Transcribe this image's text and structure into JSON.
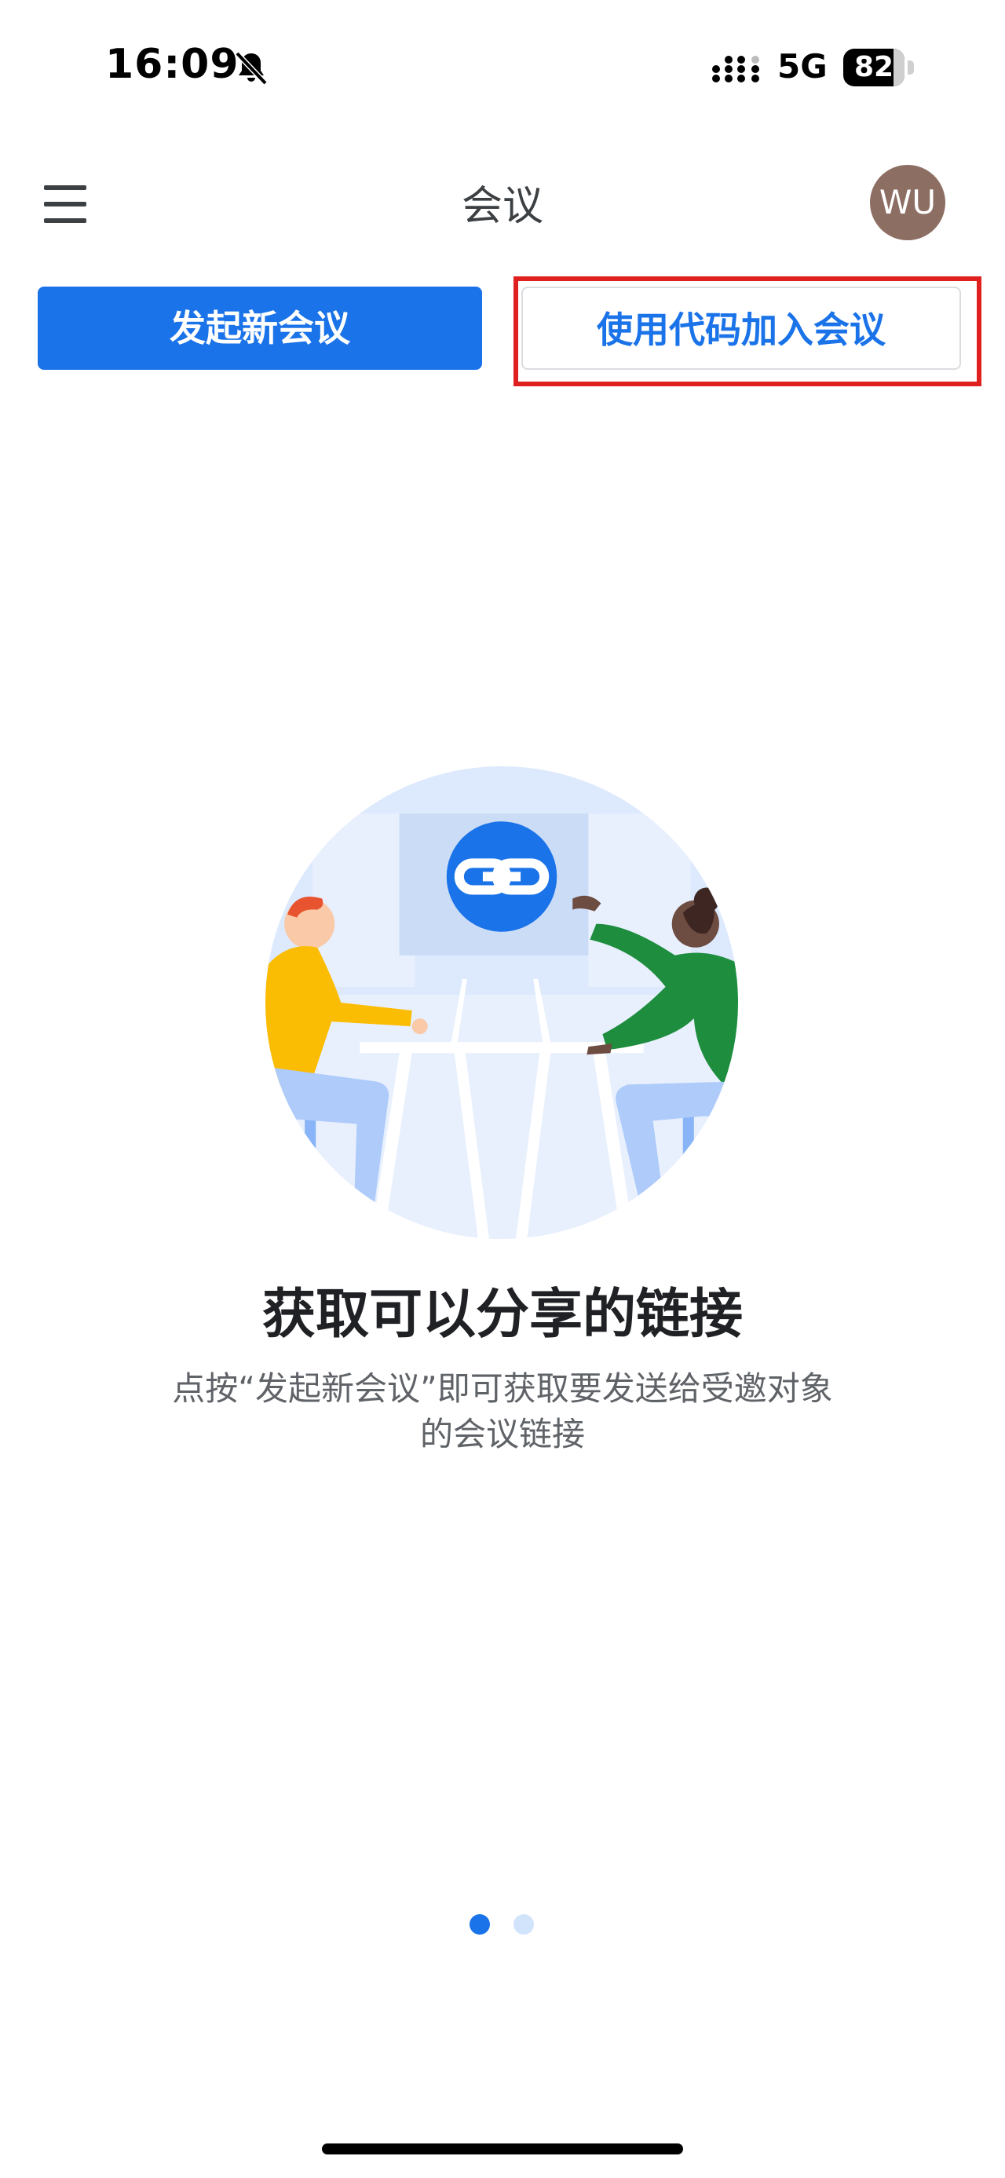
{
  "status_bar": {
    "time": "16:09",
    "network": "5G",
    "battery": "82"
  },
  "header": {
    "title": "会议",
    "avatar_initials": "WU"
  },
  "actions": {
    "new_meeting": "发起新会议",
    "join_with_code": "使用代码加入会议"
  },
  "carousel": {
    "headline": "获取可以分享的链接",
    "description": "点按“发起新会议”即可获取要发送给受邀对象的会议链接",
    "page_count": 2,
    "current_page": 1
  },
  "colors": {
    "accent": "#1a73e8",
    "highlight": "#e0201f",
    "avatar": "#8d6e63"
  }
}
